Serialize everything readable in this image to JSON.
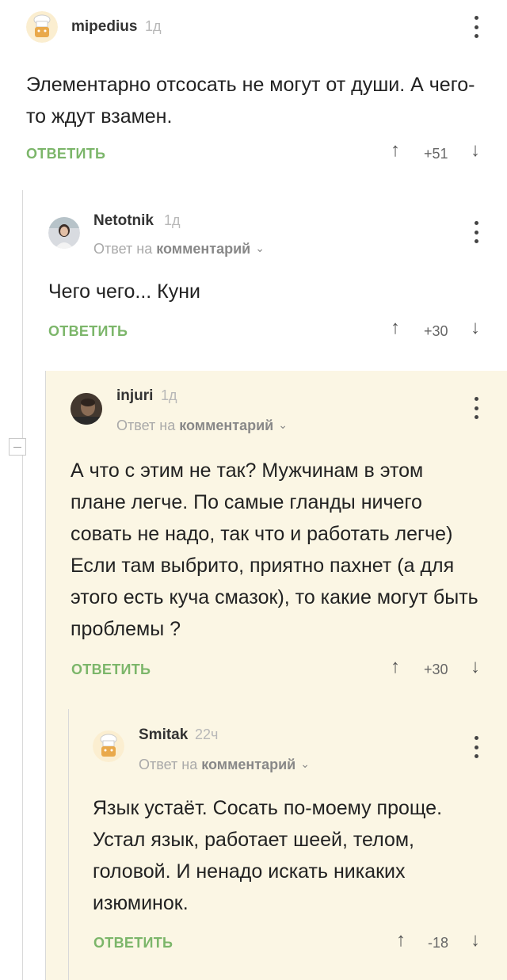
{
  "comments": [
    {
      "username": "mipedius",
      "time": "1д",
      "text": "Элементарно отсосать не могут от души. А чего-то ждут взамен.",
      "reply_label": "ОТВЕТИТЬ",
      "score": "+51",
      "avatar": "chef-hat-avatar"
    },
    {
      "username": "Netotnik",
      "time": "1д",
      "reply_to_prefix": "Ответ на",
      "reply_to_link": "комментарий",
      "text": "Чего чего... Куни",
      "reply_label": "ОТВЕТИТЬ",
      "score": "+30",
      "avatar": "photo-avatar"
    },
    {
      "username": "injuri",
      "time": "1д",
      "reply_to_prefix": "Ответ на",
      "reply_to_link": "комментарий",
      "text": "А что с этим не так? Мужчинам в этом плане легче. По самые гланды ничего совать не надо, так что и работать легче) Если там выбрито, приятно пахнет (а для этого есть куча смазок), то какие могут быть проблемы ?",
      "reply_label": "ОТВЕТИТЬ",
      "score": "+30",
      "avatar": "photo-avatar"
    },
    {
      "username": "Smitak",
      "time": "22ч",
      "reply_to_prefix": "Ответ на",
      "reply_to_link": "комментарий",
      "text": "Язык устаёт. Сосать по-моему проще. Устал язык, работает шеей, телом, головой.  И ненадо искать никаких изюминок.",
      "reply_label": "ОТВЕТИТЬ",
      "score": "-18",
      "avatar": "chef-hat-avatar"
    }
  ],
  "icons": {
    "upvote": "↑",
    "downvote": "↓",
    "chevron": "⌄"
  },
  "colors": {
    "reply_green": "#7cb66a",
    "highlight_bg": "#fbf6e4"
  }
}
